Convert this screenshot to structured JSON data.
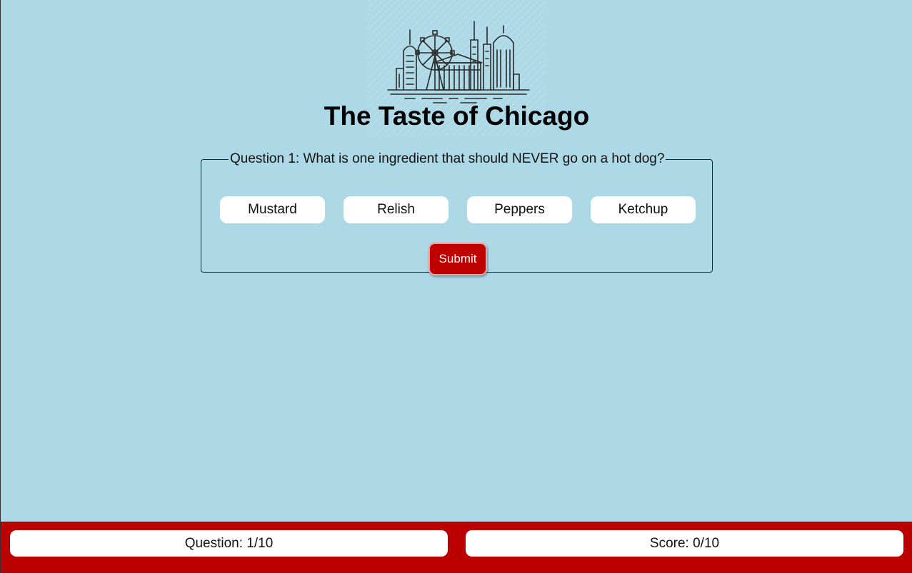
{
  "header": {
    "title": "The Taste of Chicago",
    "logo_icon": "chicago-skyline-icon"
  },
  "quiz": {
    "question": "Question 1: What is one ingredient that should NEVER go on a hot dog?",
    "answers": [
      "Mustard",
      "Relish",
      "Peppers",
      "Ketchup"
    ],
    "submit_label": "Submit"
  },
  "footer": {
    "question_progress": "Question: 1/10",
    "score": "Score: 0/10"
  },
  "colors": {
    "background": "#add8e6",
    "accent_red": "#c00000",
    "footer_red": "#bb0000"
  }
}
